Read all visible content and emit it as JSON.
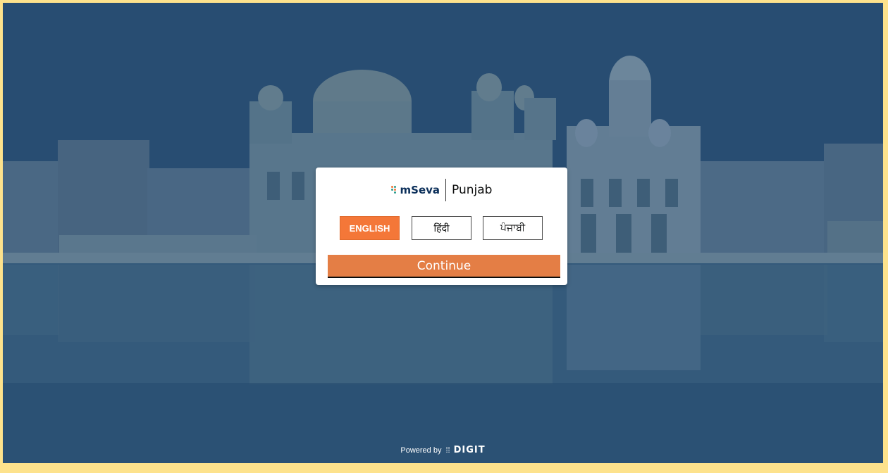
{
  "brand": {
    "logo_icon": "mseva-dots-icon",
    "name": "mSeva",
    "city": "Punjab"
  },
  "languages": [
    {
      "label": "ENGLISH",
      "selected": true
    },
    {
      "label": "हिंदी",
      "selected": false
    },
    {
      "label": "ਪੰਜਾਬੀ",
      "selected": false
    }
  ],
  "actions": {
    "continue_label": "Continue"
  },
  "footer": {
    "powered_by": "Powered by",
    "digit_icon": "digit-dots-icon",
    "digit_label": "DIGIT"
  },
  "colors": {
    "page_border": "#fde28c",
    "accent": "#f47738",
    "continue_bg": "#e47e45",
    "brand_text": "#0b2f5a"
  },
  "background": {
    "description_icon": "golden-temple-background"
  }
}
